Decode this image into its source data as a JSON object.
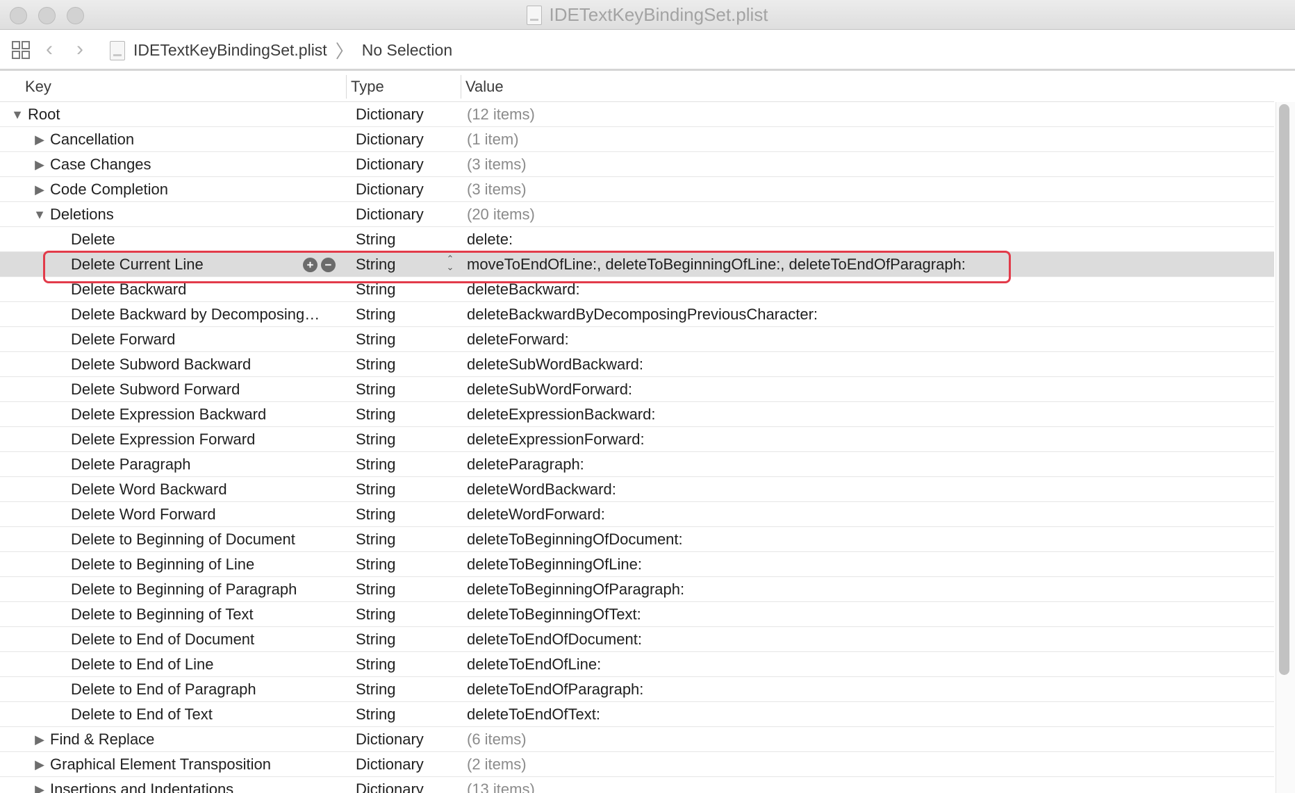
{
  "window": {
    "title": "IDETextKeyBindingSet.plist"
  },
  "jumpbar": {
    "file": "IDETextKeyBindingSet.plist",
    "selection": "No Selection",
    "separator": "〉"
  },
  "table": {
    "headers": {
      "key": "Key",
      "type": "Type",
      "value": "Value"
    },
    "rows": [
      {
        "key": "Root",
        "type": "Dictionary",
        "value": "(12 items)",
        "indent": 0,
        "expander": "expanded",
        "muted": true
      },
      {
        "key": "Cancellation",
        "type": "Dictionary",
        "value": "(1 item)",
        "indent": 1,
        "expander": "collapsed",
        "muted": true
      },
      {
        "key": "Case Changes",
        "type": "Dictionary",
        "value": "(3 items)",
        "indent": 1,
        "expander": "collapsed",
        "muted": true
      },
      {
        "key": "Code Completion",
        "type": "Dictionary",
        "value": "(3 items)",
        "indent": 1,
        "expander": "collapsed",
        "muted": true
      },
      {
        "key": "Deletions",
        "type": "Dictionary",
        "value": "(20 items)",
        "indent": 1,
        "expander": "expanded",
        "muted": true
      },
      {
        "key": "Delete",
        "type": "String",
        "value": "delete:",
        "indent": 2,
        "expander": "none",
        "muted": false
      },
      {
        "key": "Delete Current Line",
        "type": "String",
        "value": "moveToEndOfLine:, deleteToBeginningOfLine:, deleteToEndOfParagraph:",
        "indent": 2,
        "expander": "none",
        "muted": false,
        "selected": true
      },
      {
        "key": "Delete Backward",
        "type": "String",
        "value": "deleteBackward:",
        "indent": 2,
        "expander": "none",
        "muted": false
      },
      {
        "key": "Delete Backward by Decomposing…",
        "type": "String",
        "value": "deleteBackwardByDecomposingPreviousCharacter:",
        "indent": 2,
        "expander": "none",
        "muted": false
      },
      {
        "key": "Delete Forward",
        "type": "String",
        "value": "deleteForward:",
        "indent": 2,
        "expander": "none",
        "muted": false
      },
      {
        "key": "Delete Subword Backward",
        "type": "String",
        "value": "deleteSubWordBackward:",
        "indent": 2,
        "expander": "none",
        "muted": false
      },
      {
        "key": "Delete Subword Forward",
        "type": "String",
        "value": "deleteSubWordForward:",
        "indent": 2,
        "expander": "none",
        "muted": false
      },
      {
        "key": "Delete Expression Backward",
        "type": "String",
        "value": "deleteExpressionBackward:",
        "indent": 2,
        "expander": "none",
        "muted": false
      },
      {
        "key": "Delete Expression Forward",
        "type": "String",
        "value": "deleteExpressionForward:",
        "indent": 2,
        "expander": "none",
        "muted": false
      },
      {
        "key": "Delete Paragraph",
        "type": "String",
        "value": "deleteParagraph:",
        "indent": 2,
        "expander": "none",
        "muted": false
      },
      {
        "key": "Delete Word Backward",
        "type": "String",
        "value": "deleteWordBackward:",
        "indent": 2,
        "expander": "none",
        "muted": false
      },
      {
        "key": "Delete Word Forward",
        "type": "String",
        "value": "deleteWordForward:",
        "indent": 2,
        "expander": "none",
        "muted": false
      },
      {
        "key": "Delete to Beginning of Document",
        "type": "String",
        "value": "deleteToBeginningOfDocument:",
        "indent": 2,
        "expander": "none",
        "muted": false
      },
      {
        "key": "Delete to Beginning of Line",
        "type": "String",
        "value": "deleteToBeginningOfLine:",
        "indent": 2,
        "expander": "none",
        "muted": false
      },
      {
        "key": "Delete to Beginning of Paragraph",
        "type": "String",
        "value": "deleteToBeginningOfParagraph:",
        "indent": 2,
        "expander": "none",
        "muted": false
      },
      {
        "key": "Delete to Beginning of Text",
        "type": "String",
        "value": "deleteToBeginningOfText:",
        "indent": 2,
        "expander": "none",
        "muted": false
      },
      {
        "key": "Delete to End of Document",
        "type": "String",
        "value": "deleteToEndOfDocument:",
        "indent": 2,
        "expander": "none",
        "muted": false
      },
      {
        "key": "Delete to End of Line",
        "type": "String",
        "value": "deleteToEndOfLine:",
        "indent": 2,
        "expander": "none",
        "muted": false
      },
      {
        "key": "Delete to End of Paragraph",
        "type": "String",
        "value": "deleteToEndOfParagraph:",
        "indent": 2,
        "expander": "none",
        "muted": false
      },
      {
        "key": "Delete to End of Text",
        "type": "String",
        "value": "deleteToEndOfText:",
        "indent": 2,
        "expander": "none",
        "muted": false
      },
      {
        "key": "Find & Replace",
        "type": "Dictionary",
        "value": "(6 items)",
        "indent": 1,
        "expander": "collapsed",
        "muted": true
      },
      {
        "key": "Graphical Element Transposition",
        "type": "Dictionary",
        "value": "(2 items)",
        "indent": 1,
        "expander": "collapsed",
        "muted": true
      },
      {
        "key": "Insertions and Indentations",
        "type": "Dictionary",
        "value": "(13 items)",
        "indent": 1,
        "expander": "collapsed",
        "muted": true
      }
    ]
  },
  "icons": {
    "expanded": "disclosure-expanded-icon",
    "collapsed": "disclosure-collapsed-icon",
    "add": "add-row-icon",
    "remove": "remove-row-icon",
    "grid": "related-items-grid-icon",
    "back": "back-chevron-icon",
    "forward": "forward-chevron-icon"
  },
  "colors": {
    "highlight_border": "#e23b4a",
    "selected_row": "#dcdcdc",
    "muted_text": "#8b8b8b"
  }
}
